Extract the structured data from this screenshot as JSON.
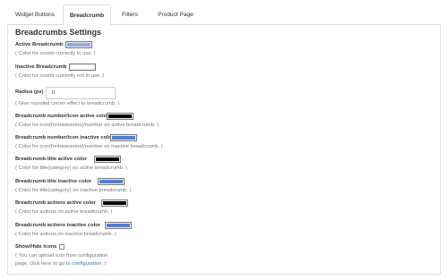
{
  "tabs": [
    "Widget Buttons",
    "Breadcrumb",
    "Filters",
    "Product Page"
  ],
  "title": "Breadcrumbs Settings",
  "active_breadcrumb": {
    "label": "Active Breadcrumb",
    "help": "( Color for crumb currently in use. )",
    "color": "#8fa9e6"
  },
  "inactive_breadcrumb": {
    "label": "Inactive Breadcrumb",
    "help": "( Color for crumb currently not in use. )",
    "color": "#ffffff"
  },
  "radius": {
    "label": "Radius (px)",
    "value": "0",
    "help": "( Give rounded corner effect to breadcrumb. )"
  },
  "number_icon_active": {
    "label": "Breadcrumb number/icon active color",
    "help": "( Color for icon(fontawesome)/number on active breadcrumb. )",
    "color": "#000000"
  },
  "number_icon_inactive": {
    "label": "Breadcrumb number/icon inactive color",
    "help": "( Color for icon(fontawesome)/number on inactive breadcrumb. )",
    "color": "#4a7ee0"
  },
  "title_active": {
    "label": "Breadcrumb title active color",
    "help": "( Color for title(category) on active breadcrumb. )",
    "color": "#000000"
  },
  "title_inactive": {
    "label": "Breadcrumb title inactive color",
    "help": "( Color for title(category) on inactive breadcrumb. )",
    "color": "#4a7ee0"
  },
  "actions_active": {
    "label": "Breadcrumb actions active color",
    "help": "( Color for actions on active breadcrumb. )",
    "color": "#000000"
  },
  "actions_inactive": {
    "label": "Breadcrumb actions inactive color",
    "help": "( Color for actions on inactive breadcrumb. )",
    "color": "#4a7ee0"
  },
  "show_hide_icons": {
    "label": "Show/Hide Icons",
    "help_line1": "( You can upload icon from configuration",
    "help_line2_prefix": "page, click here to go to ",
    "help_link": "configuration.",
    "help_line2_suffix": " )"
  }
}
